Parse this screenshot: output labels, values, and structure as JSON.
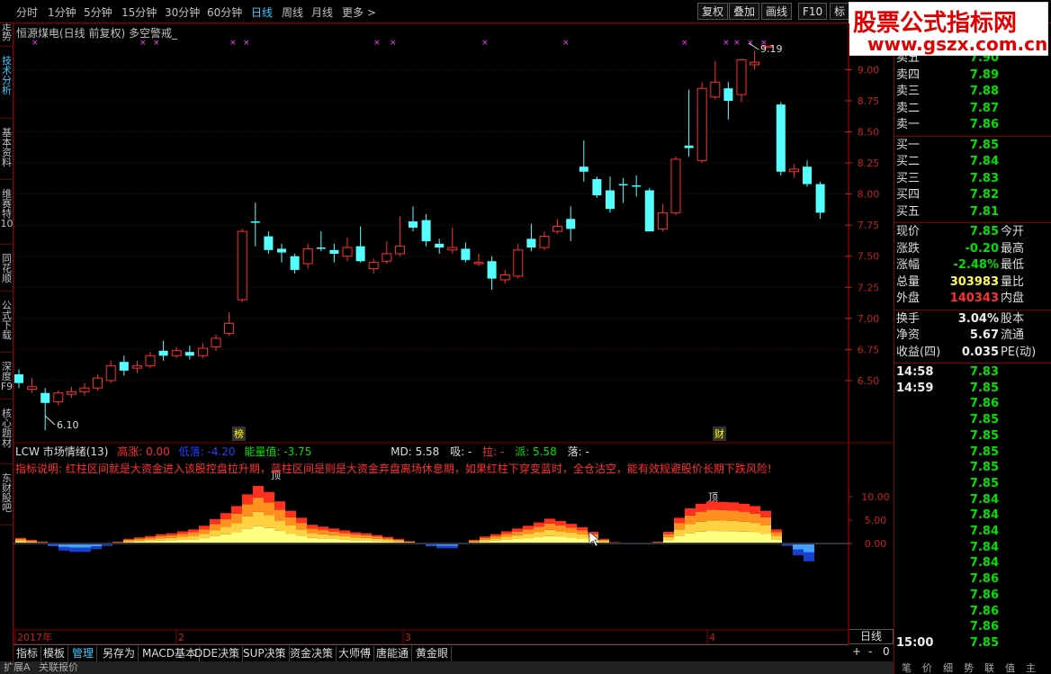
{
  "period_tabs": [
    "分时",
    "1分钟",
    "5分钟",
    "15分钟",
    "30分钟",
    "60分钟",
    "日线",
    "周线",
    "月线",
    "更多 >"
  ],
  "active_period": "日线",
  "toolbar": {
    "fuquan": "复权",
    "diejia": "叠加",
    "huaxian": "画线",
    "f10": "F10",
    "biao": "标"
  },
  "left_tabs": [
    "分时走势",
    "技术分析",
    "基本资料",
    "维赛特10",
    "同花顺",
    "公式下载",
    "深度F9",
    "核心题材",
    "东财股吧"
  ],
  "active_left_tab": "技术分析",
  "watermark": {
    "line1": "股票公式指标网",
    "line2": "www.gszx.com.cn"
  },
  "main_chart": {
    "title": "恒源煤电(日线 前复权) 多空警戒_",
    "high_label": "9.19",
    "low_label": "6.10",
    "marker1": "榜",
    "marker2": "财",
    "y_ticks": [
      "9.00",
      "8.75",
      "8.50",
      "8.25",
      "8.00",
      "7.75",
      "7.50",
      "7.25",
      "7.00",
      "6.75",
      "6.50"
    ]
  },
  "chart_data": {
    "type": "candlestick",
    "ylim": [
      6.0,
      9.3
    ],
    "candles": [
      [
        6.55,
        6.48,
        6.59,
        6.44
      ],
      [
        6.43,
        6.45,
        6.52,
        6.4
      ],
      [
        6.4,
        6.32,
        6.44,
        6.1
      ],
      [
        6.33,
        6.4,
        6.42,
        6.3
      ],
      [
        6.39,
        6.41,
        6.45,
        6.36
      ],
      [
        6.41,
        6.44,
        6.48,
        6.38
      ],
      [
        6.44,
        6.52,
        6.55,
        6.42
      ],
      [
        6.5,
        6.62,
        6.66,
        6.48
      ],
      [
        6.65,
        6.58,
        6.7,
        6.54
      ],
      [
        6.6,
        6.62,
        6.66,
        6.56
      ],
      [
        6.62,
        6.7,
        6.73,
        6.6
      ],
      [
        6.74,
        6.7,
        6.82,
        6.66
      ],
      [
        6.7,
        6.74,
        6.77,
        6.68
      ],
      [
        6.73,
        6.7,
        6.78,
        6.67
      ],
      [
        6.7,
        6.76,
        6.8,
        6.68
      ],
      [
        6.77,
        6.84,
        6.87,
        6.74
      ],
      [
        6.88,
        6.96,
        7.05,
        6.86
      ],
      [
        7.15,
        7.7,
        7.72,
        7.13
      ],
      [
        7.78,
        7.77,
        7.93,
        7.58
      ],
      [
        7.66,
        7.55,
        7.7,
        7.52
      ],
      [
        7.56,
        7.53,
        7.6,
        7.45
      ],
      [
        7.5,
        7.39,
        7.52,
        7.36
      ],
      [
        7.44,
        7.56,
        7.6,
        7.4
      ],
      [
        7.57,
        7.56,
        7.7,
        7.54
      ],
      [
        7.55,
        7.52,
        7.6,
        7.45
      ],
      [
        7.5,
        7.57,
        7.65,
        7.46
      ],
      [
        7.58,
        7.46,
        7.74,
        7.45
      ],
      [
        7.4,
        7.45,
        7.48,
        7.36
      ],
      [
        7.46,
        7.52,
        7.62,
        7.44
      ],
      [
        7.52,
        7.58,
        7.82,
        7.5
      ],
      [
        7.78,
        7.73,
        7.9,
        7.7
      ],
      [
        7.79,
        7.62,
        7.84,
        7.58
      ],
      [
        7.6,
        7.57,
        7.64,
        7.52
      ],
      [
        7.55,
        7.57,
        7.73,
        7.52
      ],
      [
        7.56,
        7.47,
        7.61,
        7.45
      ],
      [
        7.45,
        7.45,
        7.52,
        7.42
      ],
      [
        7.46,
        7.32,
        7.5,
        7.23
      ],
      [
        7.31,
        7.35,
        7.39,
        7.28
      ],
      [
        7.34,
        7.55,
        7.6,
        7.32
      ],
      [
        7.64,
        7.57,
        7.76,
        7.54
      ],
      [
        7.57,
        7.66,
        7.7,
        7.55
      ],
      [
        7.7,
        7.74,
        7.8,
        7.68
      ],
      [
        7.8,
        7.72,
        7.9,
        7.62
      ],
      [
        8.22,
        8.18,
        8.43,
        8.1
      ],
      [
        8.12,
        7.99,
        8.14,
        7.97
      ],
      [
        8.03,
        7.88,
        8.14,
        7.85
      ],
      [
        8.08,
        8.07,
        8.13,
        7.93
      ],
      [
        8.07,
        8.06,
        8.15,
        7.98
      ],
      [
        8.03,
        7.7,
        8.05,
        7.7
      ],
      [
        7.72,
        7.85,
        7.92,
        7.7
      ],
      [
        7.85,
        8.28,
        8.3,
        7.83
      ],
      [
        8.39,
        8.37,
        8.84,
        8.3
      ],
      [
        8.27,
        8.85,
        8.9,
        8.25
      ],
      [
        8.78,
        8.9,
        9.07,
        8.76
      ],
      [
        8.85,
        8.75,
        8.9,
        8.6
      ],
      [
        8.8,
        9.08,
        9.09,
        8.74
      ],
      [
        9.04,
        9.06,
        9.15,
        9.0
      ],
      [
        9.19,
        9.19,
        9.19,
        9.19
      ],
      [
        8.72,
        8.18,
        8.74,
        8.15
      ],
      [
        8.18,
        8.2,
        8.24,
        8.13
      ],
      [
        8.22,
        8.08,
        8.27,
        8.06
      ],
      [
        8.08,
        7.85,
        8.1,
        7.8
      ]
    ]
  },
  "indicator": {
    "title": "LCW 市场情绪(13)",
    "gaozhang": "高涨: 0.00",
    "dijiang": "低落: -4.20",
    "nengliang": "能量值: -3.75",
    "md": "MD: 5.58",
    "xi": "吸: -",
    "la": "拉: -",
    "pai": "派: 5.58",
    "luo": "落: -",
    "desc": "指标说明: 红柱区间就是大资金进入该股控盘拉升期，蓝柱区间是则是大资金弃盘离场休息期，如果红柱下穿变蓝时，全仓沽空，能有效规避股价长期下跌风险!",
    "top_label1": "顶",
    "top_label2": "顶",
    "y_ticks": [
      "10.00",
      "5.00",
      "0.00"
    ],
    "values": [
      1.2,
      0.8,
      0.4,
      -0.6,
      -1.5,
      -1.8,
      -1.8,
      -1.2,
      -0.5,
      0.4,
      1.0,
      1.3,
      1.6,
      2.0,
      2.2,
      2.6,
      3.0,
      3.8,
      5.2,
      6.5,
      8.0,
      10.5,
      12.3,
      11.0,
      9.0,
      7.0,
      5.5,
      4.0,
      3.6,
      3.2,
      2.8,
      2.4,
      2.2,
      1.8,
      1.4,
      1.0,
      0.5,
      -0.2,
      -0.6,
      -1.0,
      -1.0,
      0.2,
      0.8,
      1.5,
      2.0,
      2.6,
      3.2,
      3.8,
      4.5,
      5.3,
      4.8,
      4.2,
      3.5,
      2.5,
      1.0,
      0.3,
      0.2,
      0.0,
      0.0,
      0.4,
      2.5,
      5.5,
      7.5,
      8.5,
      9.0,
      8.9,
      8.8,
      8.5,
      8.0,
      7.0,
      3.0,
      -0.5,
      -2.5,
      -3.8
    ],
    "x_labels": [
      "2017年",
      "2",
      "3",
      "4"
    ]
  },
  "corner_label": "日线",
  "zoom_controls": [
    "+",
    "-",
    "0"
  ],
  "bottom_tabs": [
    "指标",
    "模板",
    "管理",
    "另存为",
    "MACD基本",
    "DDE决策",
    "SUP决策",
    "资金决策",
    "大师傅",
    "唐能通",
    "黄金眼"
  ],
  "active_bottom_tab": "管理",
  "status_bar": {
    "left": "扩展A",
    "right": "关联报价"
  },
  "order_book": {
    "sell": [
      [
        "卖五",
        "7.90"
      ],
      [
        "卖四",
        "7.89"
      ],
      [
        "卖三",
        "7.88"
      ],
      [
        "卖二",
        "7.87"
      ],
      [
        "卖一",
        "7.86"
      ]
    ],
    "buy": [
      [
        "买一",
        "7.85"
      ],
      [
        "买二",
        "7.84"
      ],
      [
        "买三",
        "7.83"
      ],
      [
        "买四",
        "7.82"
      ],
      [
        "买五",
        "7.81"
      ]
    ]
  },
  "quote": {
    "xianjia": [
      "现价",
      "7.85",
      "今开"
    ],
    "zhangdie": [
      "涨跌",
      "-0.20",
      "最高"
    ],
    "zhangfu": [
      "涨幅",
      "-2.48%",
      "最低"
    ],
    "zongliang": [
      "总量",
      "303983",
      "量比"
    ],
    "waipan": [
      "外盘",
      "140343",
      "内盘"
    ],
    "huanshou": [
      "换手",
      "3.04%",
      "股本"
    ],
    "jingzi": [
      "净资",
      "5.67",
      "流通"
    ],
    "shouyi": [
      "收益(四)",
      "0.035",
      "PE(动)"
    ]
  },
  "ticks": [
    [
      "14:58",
      "7.83"
    ],
    [
      "14:59",
      "7.85"
    ],
    [
      "",
      "7.86"
    ],
    [
      "",
      "7.85"
    ],
    [
      "",
      "7.85"
    ],
    [
      "",
      "7.85"
    ],
    [
      "",
      "7.85"
    ],
    [
      "",
      "7.85"
    ],
    [
      "",
      "7.84"
    ],
    [
      "",
      "7.84"
    ],
    [
      "",
      "7.84"
    ],
    [
      "",
      "7.84"
    ],
    [
      "",
      "7.84"
    ],
    [
      "",
      "7.86"
    ],
    [
      "",
      "7.86"
    ],
    [
      "",
      "7.86"
    ],
    [
      "",
      "7.86"
    ],
    [
      "15:00",
      "7.85"
    ]
  ],
  "rp_footer": [
    "笔",
    "价",
    "细",
    "势",
    "联",
    "值",
    "主"
  ]
}
